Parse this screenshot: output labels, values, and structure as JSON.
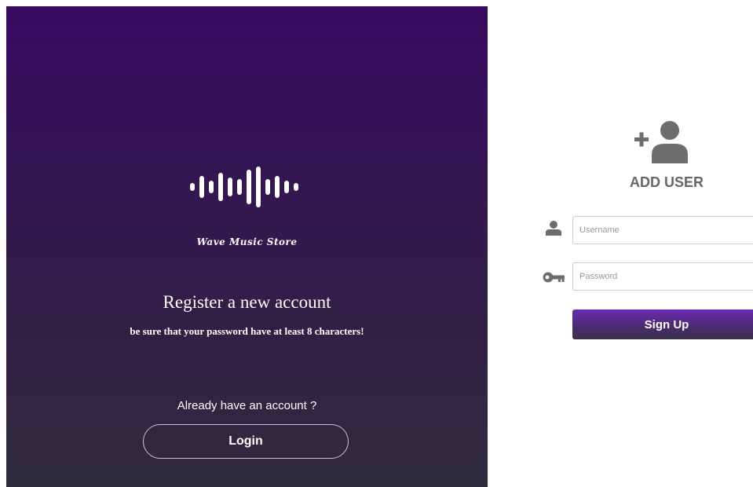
{
  "brand": {
    "name": "Wave Music Store",
    "logo_icon": "sound-wave-icon"
  },
  "left": {
    "headline": "Register a new account",
    "subline": "be sure that your password have at least 8 characters!",
    "already_text": "Already have an account ?",
    "login_label": "Login"
  },
  "form": {
    "title_icon": "add-user-icon",
    "title": "ADD USER",
    "username": {
      "placeholder": "Username",
      "value": "",
      "icon": "user-icon"
    },
    "password": {
      "placeholder": "Password",
      "value": "",
      "icon": "key-icon"
    },
    "signup_label": "Sign Up"
  },
  "colors": {
    "panel_top": "#380a62",
    "panel_bottom": "#2f2b3d",
    "accent": "#6a2bb4",
    "icon_gray": "#6d6d6d",
    "title_gray": "#666666"
  }
}
